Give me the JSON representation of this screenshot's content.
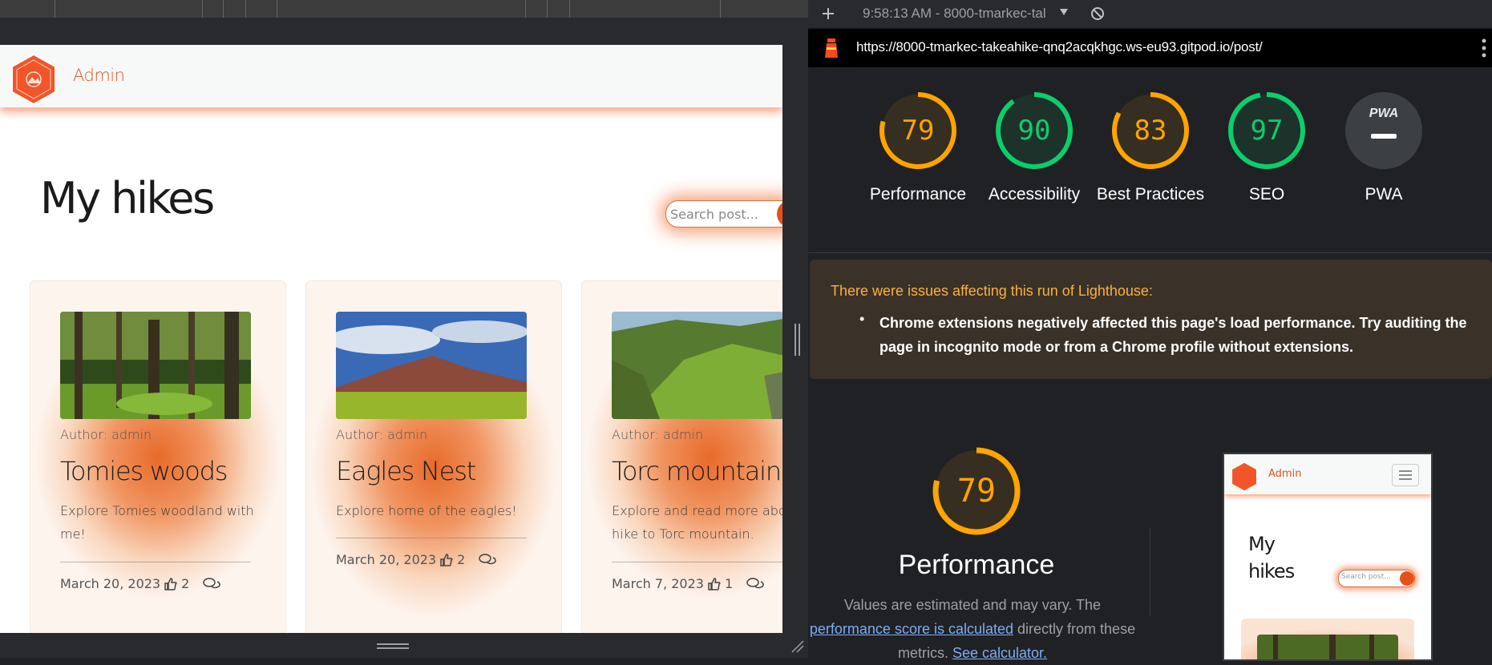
{
  "site": {
    "brand": "Admin",
    "page_title": "My hikes",
    "search_placeholder": "Search post..."
  },
  "posts": [
    {
      "author": "Author: admin",
      "title": "Tomies woods",
      "description": "Explore Tomies woodland with me!",
      "date": "March 20, 2023",
      "likes": "2"
    },
    {
      "author": "Author: admin",
      "title": "Eagles Nest",
      "description": "Explore home of the eagles!",
      "date": "March 20, 2023",
      "likes": "2"
    },
    {
      "author": "Author: admin",
      "title": "Torc mountain",
      "description": "Explore and read more about hike to Torc mountain.",
      "date": "March 7, 2023",
      "likes": "1"
    }
  ],
  "devtools": {
    "run_label": "9:58:13 AM - 8000-tmarkec-tal",
    "url": "https://8000-tmarkec-takeahike-qnq2acqkhgc.ws-eu93.gitpod.io/post/"
  },
  "lighthouse": {
    "scores": [
      {
        "label": "Performance",
        "value": "79",
        "color": "#ffa400"
      },
      {
        "label": "Accessibility",
        "value": "90",
        "color": "#0cce6b"
      },
      {
        "label": "Best Practices",
        "value": "83",
        "color": "#ffa400"
      },
      {
        "label": "SEO",
        "value": "97",
        "color": "#0cce6b"
      },
      {
        "label": "PWA",
        "value": "",
        "color": "#9aa0a6"
      }
    ],
    "pwa_badge": "PWA",
    "warning_title": "There were issues affecting this run of Lighthouse:",
    "warning_item": "Chrome extensions negatively affected this page's load performance. Try auditing the page in incognito mode or from a Chrome profile without extensions.",
    "performance_heading": "Performance",
    "performance_score": "79",
    "desc_prefix": "Values are estimated and may vary. The",
    "desc_link": "performance score is calculated",
    "desc_middle": "directly from these metrics.",
    "desc_link2": "See calculator."
  },
  "thumbnail": {
    "brand": "Admin",
    "title": "My hikes",
    "search_placeholder": "Search post..."
  }
}
